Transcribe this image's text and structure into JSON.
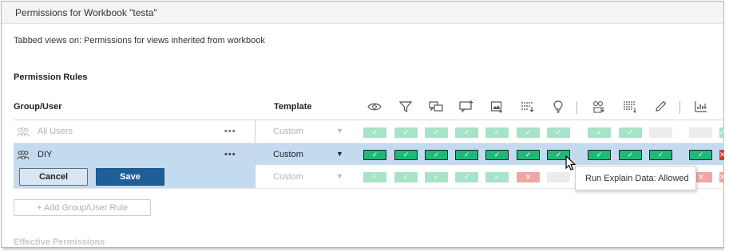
{
  "dialog": {
    "title": "Permissions for Workbook \"testa\"",
    "subtitle": "Tabbed views on: Permissions for views inherited from workbook",
    "section_heading": "Permission Rules",
    "effective_heading": "Effective Permissions"
  },
  "table": {
    "headers": {
      "group_user": "Group/User",
      "template": "Template"
    },
    "capability_icons": [
      "view-eye-icon",
      "filter-icon",
      "comments-icon",
      "add-comment-icon",
      "export-image-icon",
      "export-data-icon",
      "explain-data-lightbulb-icon",
      "download-workbook-icon",
      "download-full-data-icon",
      "web-edit-pencil-icon",
      "download-summary-data-icon"
    ],
    "rows": [
      {
        "label": "All Users",
        "more": "•••",
        "template": "Custom",
        "state": "faded",
        "cells": [
          "allow-light",
          "allow-light",
          "allow-light",
          "allow-light",
          "allow-light",
          "allow-light",
          "allow-light",
          "allow-light",
          "allow-light",
          "none",
          "none",
          "allow-light"
        ]
      },
      {
        "label": "DIY",
        "more": "•••",
        "template": "Custom",
        "state": "selected",
        "cells": [
          "allow",
          "allow",
          "allow",
          "allow",
          "allow",
          "allow",
          "allow",
          "allow",
          "allow",
          "allow",
          "allow",
          "deny"
        ]
      },
      {
        "label": "",
        "more": "",
        "template": "Custom",
        "state": "faded",
        "cells": [
          "allow-light",
          "allow-light",
          "allow-light",
          "allow-light",
          "allow-light",
          "deny-light",
          "none",
          "none",
          "none",
          "none",
          "deny-light",
          "deny-light"
        ]
      }
    ]
  },
  "buttons": {
    "cancel": "Cancel",
    "save": "Save",
    "add_rule": "+ Add Group/User Rule"
  },
  "tooltip": {
    "text": "Run Explain Data: Allowed"
  },
  "colors": {
    "allowed": "#1fb878",
    "allowed_inherited": "#a6e3c9",
    "denied": "#d93838",
    "denied_inherited": "#f1a6a6",
    "selection": "#c4dbef",
    "save_button": "#1f5f99"
  }
}
